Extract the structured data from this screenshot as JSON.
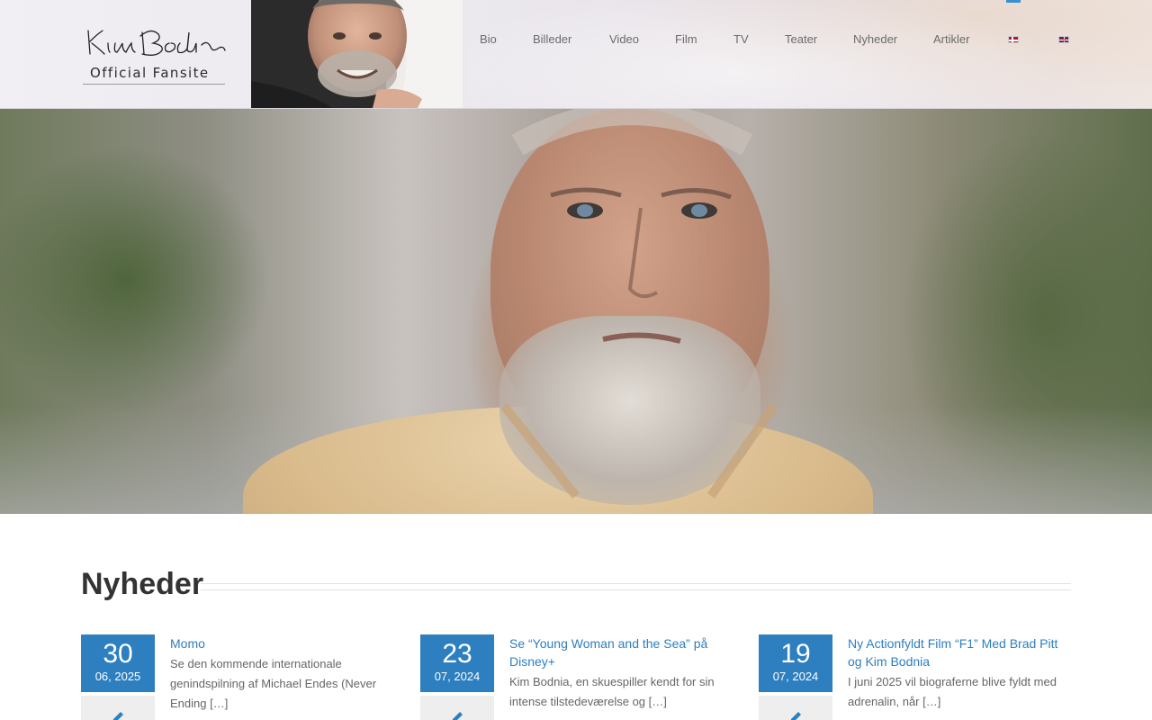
{
  "site": {
    "logo_signature": "Kim Bodnia",
    "logo_subtitle": "Official Fansite"
  },
  "nav": {
    "items": [
      "Bio",
      "Billeder",
      "Video",
      "Film",
      "TV",
      "Teater",
      "Nyheder",
      "Artikler"
    ],
    "languages": [
      "danish-flag-icon",
      "english-flag-icon"
    ],
    "active_language_color": "#3a8fcf"
  },
  "news": {
    "heading": "Nyheder",
    "accent_color": "#2d7fc0",
    "posts": [
      {
        "day": "30",
        "month_year": "06, 2025",
        "title": "Momo",
        "excerpt": "Se den kommende internationale genindspilning af Michael Endes (Never Ending […]"
      },
      {
        "day": "23",
        "month_year": "07, 2024",
        "title": "Se “Young Woman and the Sea” på Disney+",
        "excerpt": "Kim Bodnia, en skuespiller kendt for sin intense tilstedeværelse og […]"
      },
      {
        "day": "19",
        "month_year": "07, 2024",
        "title": "Ny Actionfyldt Film “F1” Med Brad Pitt og Kim Bodnia",
        "excerpt": "I juni 2025 vil biograferne blive fyldt med adrenalin, når […]"
      }
    ]
  }
}
